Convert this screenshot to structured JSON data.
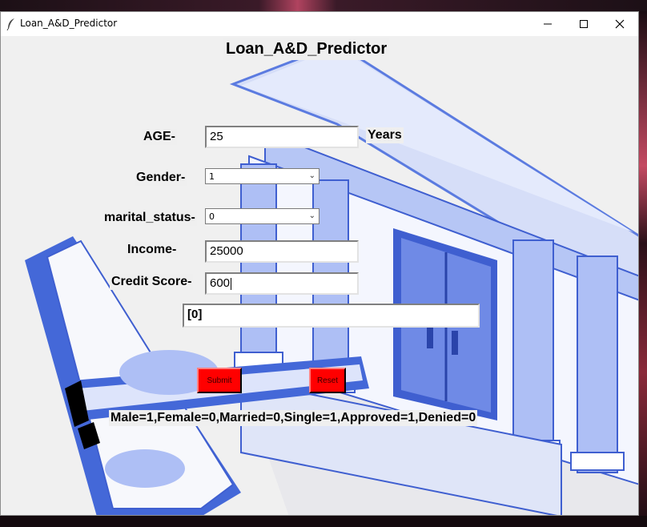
{
  "window": {
    "title": "Loan_A&D_Predictor",
    "minimize_icon": "minimize-icon",
    "maximize_icon": "maximize-icon",
    "close_icon": "close-icon",
    "app_icon": "feather-icon"
  },
  "form": {
    "heading": "Loan_A&D_Predictor",
    "age_label": "AGE-",
    "age_value": "25",
    "age_unit": "Years",
    "gender_label": "Gender-",
    "gender_value": "1",
    "marital_label": "marital_status-",
    "marital_value": "0",
    "income_label": "Income-",
    "income_value": "25000",
    "credit_label": "Credit Score-",
    "credit_value": "600",
    "result_value": "[0]",
    "submit_label": "Submit",
    "reset_label": "Reset",
    "legend": "Male=1,Female=0,Married=0,Single=1,Approved=1,Denied=0"
  },
  "colors": {
    "button": "#ff0000",
    "background_art": "#5b7be0"
  }
}
